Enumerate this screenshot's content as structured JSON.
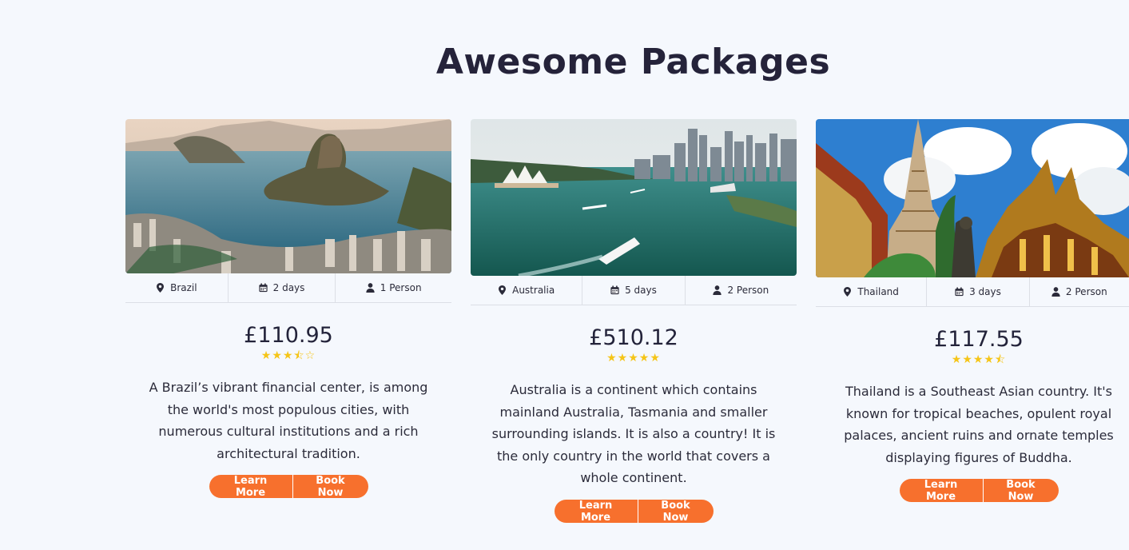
{
  "section": {
    "title": "Awesome Packages"
  },
  "packages": [
    {
      "image_alt": "Rio de Janeiro coastline with Sugarloaf Mountain",
      "location": "Brazil",
      "duration": "2 days",
      "people": "1 Person",
      "price": "£110.95",
      "stars": "★★★⯪☆",
      "rating": 3.5,
      "description": "A Brazil’s vibrant financial center, is among the world's most populous cities, with numerous cultural institutions and a rich architectural tradition.",
      "learn_more": "Learn More",
      "book_now": "Book Now"
    },
    {
      "image_alt": "Sydney harbour with Opera House and city skyline",
      "location": "Australia",
      "duration": "5 days",
      "people": "2 Person",
      "price": "£510.12",
      "stars": "★★★★★",
      "rating": 5,
      "description": "Australia is a continent which contains mainland Australia, Tasmania and smaller surrounding islands. It is also a country! It is the only country in the world that covers a whole continent.",
      "learn_more": "Learn More",
      "book_now": "Book Now"
    },
    {
      "image_alt": "Thai temples with golden roofs and a Buddha statue",
      "location": "Thailand",
      "duration": "3 days",
      "people": "2 Person",
      "price": "£117.55",
      "stars": "★★★★⯪",
      "rating": 4.5,
      "description": "Thailand is a Southeast Asian country. It's known for tropical beaches, opulent royal palaces, ancient ruins and ornate temples displaying figures of Buddha.",
      "learn_more": "Learn More",
      "book_now": "Book Now"
    }
  ],
  "icons": {
    "location": "map-pin-icon",
    "duration": "calendar-icon",
    "people": "user-icon"
  },
  "colors": {
    "accent": "#f7702d",
    "star": "#f5c518",
    "text": "#23233a",
    "background": "#f5f8fd"
  }
}
